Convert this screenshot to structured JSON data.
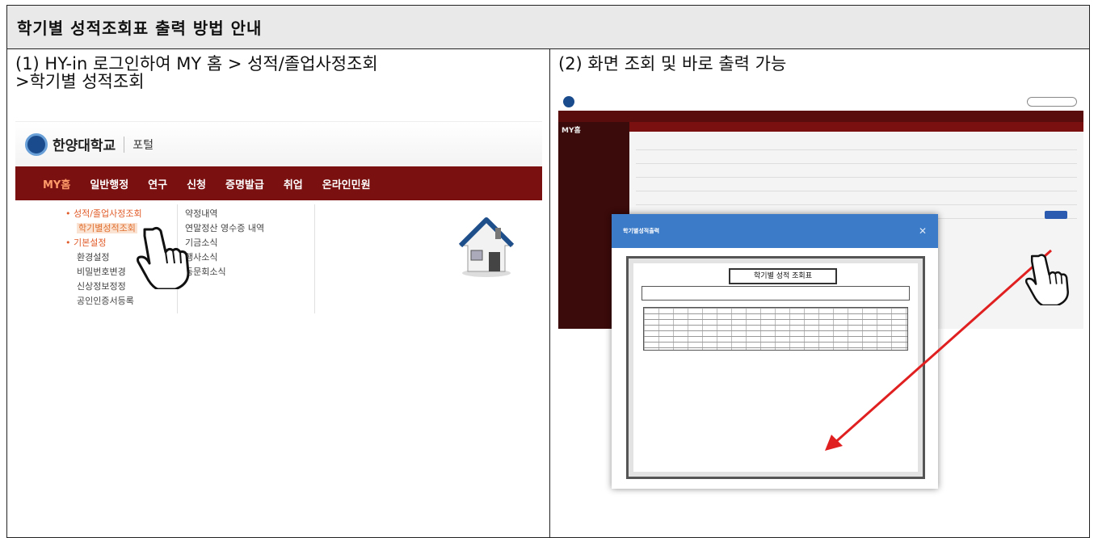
{
  "document": {
    "title": "학기별 성적조회표 출력 방법 안내"
  },
  "left_column": {
    "instruction_line1": "(1) HY-in 로그인하여 MY 홈 > 성적/졸업사정조회",
    "instruction_line2": ">학기별 성적조회",
    "portal": {
      "logo_text": "한양대학교",
      "portal_label": "포털",
      "nav": [
        "MY홈",
        "일반행정",
        "연구",
        "신청",
        "증명발급",
        "취업",
        "온라인민원"
      ],
      "menu_col1": [
        "• 성적/졸업사정조회",
        "학기별성적조회",
        "• 기본설정",
        "환경설정",
        "비밀번호변경",
        "신상정보정정",
        "공인인증서등록"
      ],
      "menu_col2": [
        "약정내역",
        "연말정산 영수증 내역",
        "기금소식",
        "행사소식",
        "동문회소식"
      ]
    }
  },
  "right_column": {
    "instruction": "(2) 화면 조회 및 바로 출력 가능",
    "popup": {
      "header": "학기별성적출력",
      "doc_title": "학기별 성적 조회표"
    }
  },
  "colors": {
    "nav_maroon": "#7a1010",
    "popup_blue": "#3c7bc8",
    "arrow_red": "#e02020"
  }
}
